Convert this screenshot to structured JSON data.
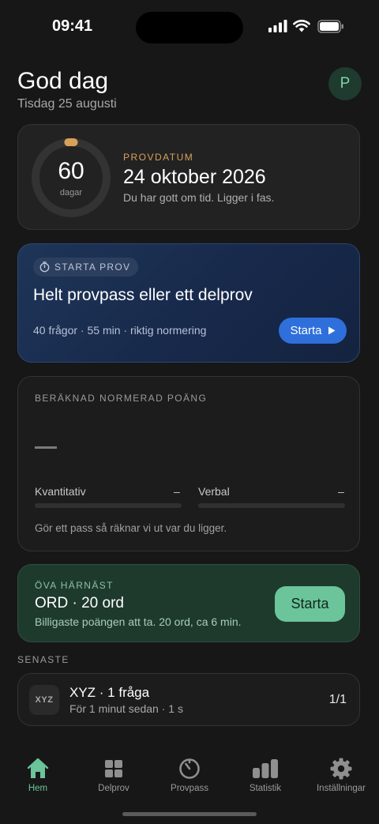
{
  "status_bar": {
    "time": "09:41"
  },
  "header": {
    "greeting": "God dag",
    "date": "Tisdag 25 augusti",
    "avatar_initial": "P"
  },
  "countdown": {
    "days": "60",
    "days_unit": "dagar",
    "label": "PROVDATUM",
    "exam_date": "24 oktober 2026",
    "message": "Du har gott om tid. Ligger i fas."
  },
  "start_exam": {
    "badge": "STARTA PROV",
    "title": "Helt provpass eller ett delprov",
    "meta": "40 frågor · 55 min · riktig normering",
    "button": "Starta"
  },
  "score": {
    "label": "BERÄKNAD NORMERAD POÄNG",
    "quant_label": "Kvantitativ",
    "quant_value": "–",
    "verbal_label": "Verbal",
    "verbal_value": "–",
    "footer": "Gör ett pass så räknar vi ut var du ligger."
  },
  "practice": {
    "label": "ÖVA HÄRNÄST",
    "title": "ORD · 20 ord",
    "subtitle": "Billigaste poängen att ta. 20 ord, ca 6 min.",
    "button": "Starta"
  },
  "recent": {
    "heading": "SENASTE",
    "items": [
      {
        "icon_text": "XYZ",
        "title": "XYZ · 1 fråga",
        "subtitle": "För 1 minut sedan · 1 s",
        "count": "1/1"
      }
    ]
  },
  "tabs": [
    {
      "label": "Hem",
      "icon": "home-icon",
      "active": true
    },
    {
      "label": "Delprov",
      "icon": "grid-icon",
      "active": false
    },
    {
      "label": "Provpass",
      "icon": "timer-icon",
      "active": false
    },
    {
      "label": "Statistik",
      "icon": "bar-chart-icon",
      "active": false
    },
    {
      "label": "Inställningar",
      "icon": "gear-icon",
      "active": false
    }
  ],
  "colors": {
    "accent_green": "#6bc49a",
    "accent_blue": "#2f6fdc",
    "accent_orange": "#d6a15a",
    "background": "#171717"
  }
}
